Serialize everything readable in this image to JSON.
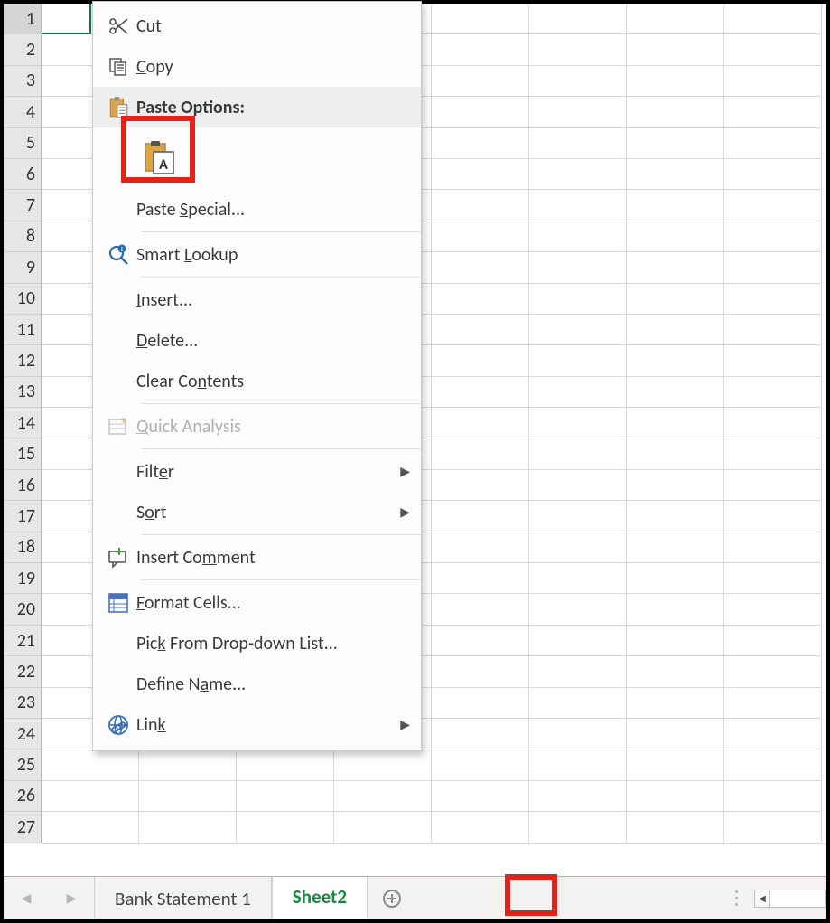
{
  "rows": [
    1,
    2,
    3,
    4,
    5,
    6,
    7,
    8,
    9,
    10,
    11,
    12,
    13,
    14,
    15,
    16,
    17,
    18,
    19,
    20,
    21,
    22,
    23,
    24,
    25,
    26,
    27
  ],
  "context_menu": {
    "cut": "Cut",
    "copy": "Copy",
    "paste_options": "Paste Options:",
    "paste_special": "Paste Special...",
    "smart_lookup": "Smart Lookup",
    "insert": "Insert...",
    "delete": "Delete...",
    "clear_contents": "Clear Contents",
    "quick_analysis": "Quick Analysis",
    "filter": "Filter",
    "sort": "Sort",
    "insert_comment": "Insert Comment",
    "format_cells": "Format Cells...",
    "pick_from_list": "Pick From Drop-down List...",
    "define_name": "Define Name...",
    "link": "Link"
  },
  "tabs": {
    "tab1": "Bank Statement 1",
    "tab2": "Sheet2"
  }
}
